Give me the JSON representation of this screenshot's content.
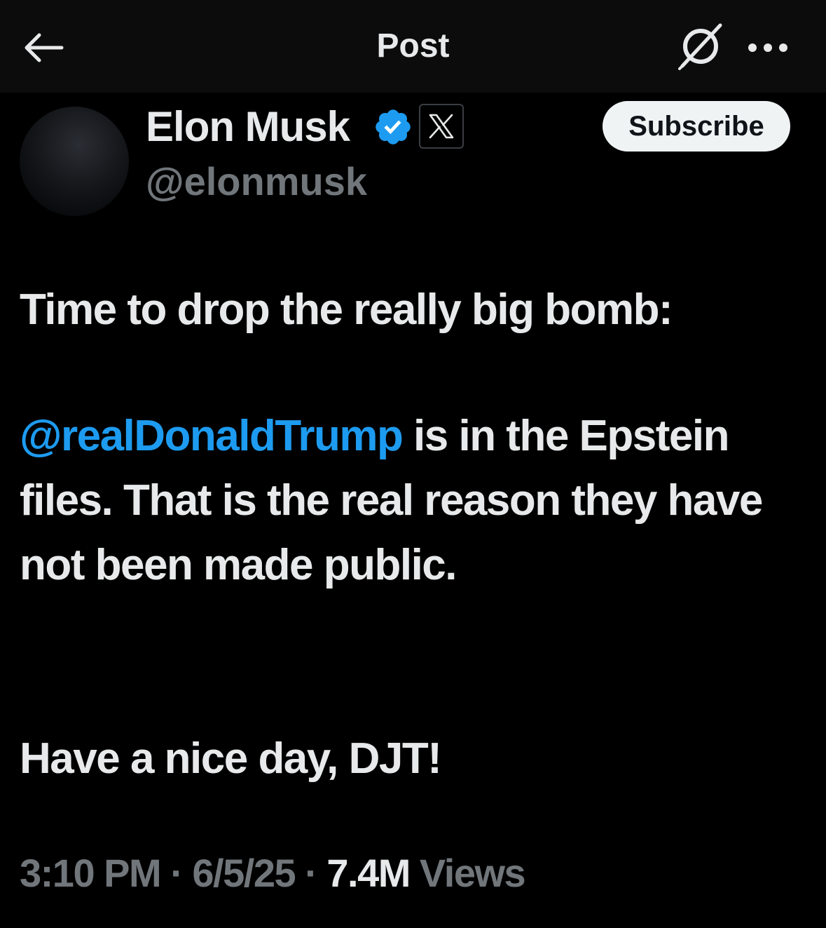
{
  "header": {
    "title": "Post",
    "back_icon": "arrow-left-icon",
    "grok_icon": "grok-icon",
    "more_icon": "more-horizontal-icon"
  },
  "author": {
    "name": "Elon Musk",
    "handle": "@elonmusk",
    "verified_icon": "verified-badge-icon",
    "affiliate_icon": "x-logo-icon",
    "subscribe_label": "Subscribe"
  },
  "post": {
    "line1": "Time to drop the really big bomb:",
    "mention": "@realDonaldTrump",
    "para2_rest": " is in the Epstein files. That is the real reason they have not been made public.",
    "para3": "Have a nice day, DJT!"
  },
  "meta": {
    "time": "3:10 PM",
    "separator": " · ",
    "date": "6/5/25",
    "views_count": "7.4M",
    "views_label": " Views"
  },
  "colors": {
    "background": "#000000",
    "header_background": "#0c0c0c",
    "text_primary": "#e7e9ea",
    "text_secondary": "#71767b",
    "accent": "#1d9bf0",
    "subscribe_bg": "#eff3f4"
  }
}
